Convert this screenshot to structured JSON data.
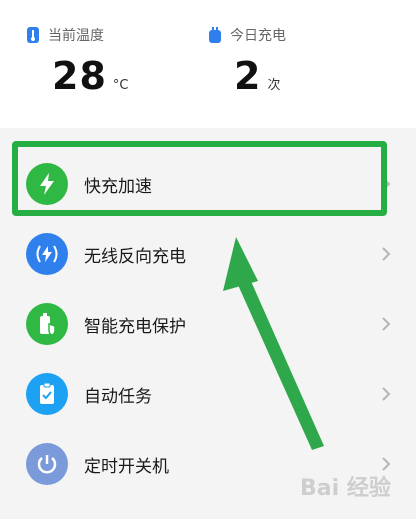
{
  "stats": {
    "temperature": {
      "label": "当前温度",
      "value": "28",
      "unit": "°C"
    },
    "charges_today": {
      "label": "今日充电",
      "value": "2",
      "unit": "次"
    }
  },
  "menu": {
    "items": [
      {
        "label": "快充加速",
        "icon": "bolt-icon",
        "color": "#2fb843"
      },
      {
        "label": "无线反向充电",
        "icon": "wireless-charge-icon",
        "color": "#2f80ed"
      },
      {
        "label": "智能充电保护",
        "icon": "battery-shield-icon",
        "color": "#2fb843"
      },
      {
        "label": "自动任务",
        "icon": "clipboard-check-icon",
        "color": "#1da1f2"
      },
      {
        "label": "定时开关机",
        "icon": "power-icon",
        "color": "#7b9ad9"
      }
    ]
  },
  "watermark": "Bai 经验"
}
